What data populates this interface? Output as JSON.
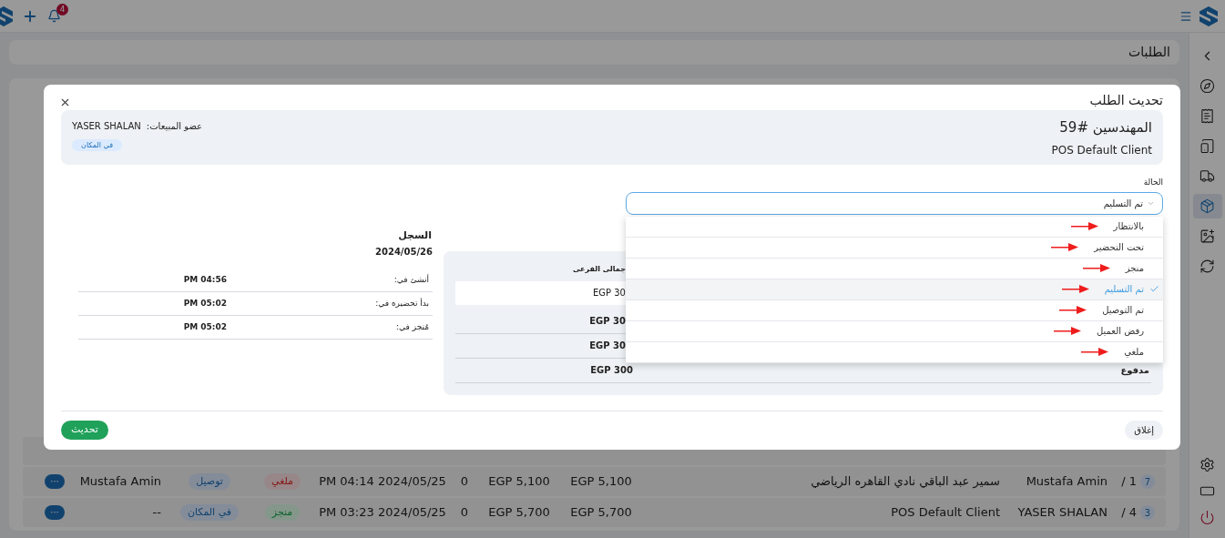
{
  "top_bar": {
    "notification_count": "4"
  },
  "sidebar": {
    "items": [
      {
        "kind": "back",
        "selected": false
      },
      {
        "kind": "promotions",
        "selected": false
      },
      {
        "kind": "receipts",
        "selected": false
      },
      {
        "kind": "devices",
        "selected": false
      },
      {
        "kind": "delivery",
        "selected": false
      },
      {
        "kind": "orders",
        "selected": true
      },
      {
        "kind": "media",
        "selected": false
      },
      {
        "kind": "sync",
        "selected": false
      }
    ],
    "bottom_items": [
      {
        "kind": "settings"
      },
      {
        "kind": "display"
      },
      {
        "kind": "logout"
      }
    ]
  },
  "page": {
    "title": "الطلبات"
  },
  "orders_table": {
    "rows": [
      {
        "column_1": {
          "text": "1 /",
          "badge": "7"
        },
        "column_2": "Mustafa Amin",
        "column_3": "سمير عبد الباقي نادي القاهره الرياضي",
        "column_4": "EGP 5,100",
        "column_5": "EGP 5,100",
        "column_6": "0",
        "column_7": "PM 04:14 2024/05/25",
        "column_8": {
          "text": "ملغي",
          "kind": "cancelled"
        },
        "column_9": "توصيل",
        "column_10": "Mustafa Amin",
        "column_11": "···"
      },
      {
        "column_1": {
          "text": "4 /",
          "badge": "3"
        },
        "column_2": "YASER SHALAN",
        "column_3": "POS Default Client",
        "column_4": "EGP 5,700",
        "column_5": "EGP 5,700",
        "column_6": "0",
        "column_7": "PM 03:23 2024/05/25",
        "column_8": {
          "text": "منجز",
          "kind": "done"
        },
        "column_9": "في المكان",
        "column_10": "--",
        "column_11": "···"
      }
    ]
  },
  "dialog": {
    "title": "تحديث الطلب",
    "order": {
      "name": "المهندسين #59",
      "customer": "POS Default Client",
      "sales_member_label": "عضو المبيعات:",
      "sales_member": "YASER SHALAN",
      "type_badge": "في المكان"
    },
    "status": {
      "label": "الحالة",
      "value": "تم التسليم",
      "options": [
        {
          "label": "بالانتظار",
          "selected": false
        },
        {
          "label": "تحت التحضير",
          "selected": false
        },
        {
          "label": "منجز",
          "selected": false
        },
        {
          "label": "تم التسليم",
          "selected": true
        },
        {
          "label": "تم التوصيل",
          "selected": false
        },
        {
          "label": "رفض العميل",
          "selected": false
        },
        {
          "label": "ملغي",
          "selected": false
        }
      ]
    },
    "summary": {
      "header": "جمالى الفرعى",
      "rows": [
        {
          "kind": "line",
          "value": "EGP 30"
        },
        {
          "kind": "total",
          "value": "EGP 30"
        },
        {
          "kind": "total",
          "value": "EGP 30"
        },
        {
          "kind": "paid",
          "label": "مدفوع",
          "value": "EGP 300"
        }
      ]
    },
    "history": {
      "title": "السجل",
      "date": "2024/05/26",
      "rows": [
        {
          "label": "أنشئ في:",
          "value": "PM 04:56"
        },
        {
          "label": "بدأ تحضيره في:",
          "value": "PM 05:02"
        },
        {
          "label": "مُنجز في:",
          "value": "PM 05:02"
        }
      ]
    },
    "buttons": {
      "update": "تحديث",
      "close": "إغلاق"
    }
  }
}
